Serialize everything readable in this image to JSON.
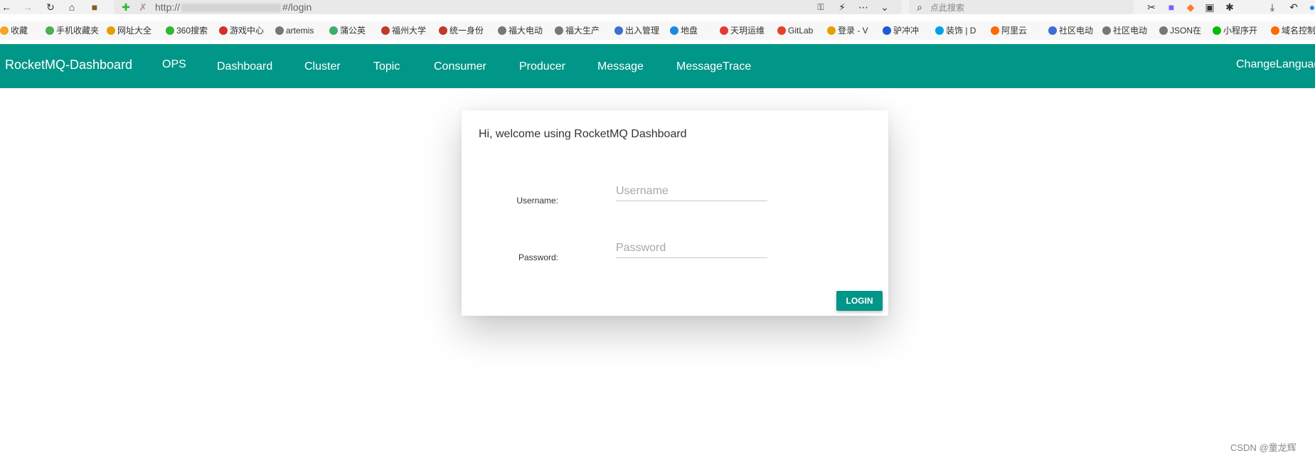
{
  "browser": {
    "url_prefix": "http://",
    "url_suffix": "#/login",
    "search_placeholder": "点此搜索",
    "bookmarks": [
      {
        "label": "收藏",
        "icon": "star-icon",
        "color": "#f5a623"
      },
      {
        "label": "手机收藏夹",
        "icon": "phone-icon",
        "color": "#4caf50"
      },
      {
        "label": "网址大全",
        "icon": "site-icon",
        "color": "#e5a000"
      },
      {
        "label": "360搜索",
        "icon": "search360-icon",
        "color": "#2eb82e"
      },
      {
        "label": "游戏中心",
        "icon": "game-icon",
        "color": "#d32f2f"
      },
      {
        "label": "artemis",
        "icon": "globe-icon",
        "color": "#777777"
      },
      {
        "label": "蒲公英",
        "icon": "dandelion-icon",
        "color": "#3fae6b"
      },
      {
        "label": "福州大学",
        "icon": "university-icon",
        "color": "#c0392b"
      },
      {
        "label": "统一身份",
        "icon": "identity-icon",
        "color": "#c0392b"
      },
      {
        "label": "福大电动",
        "icon": "globe-icon",
        "color": "#777777"
      },
      {
        "label": "福大生产",
        "icon": "globe-icon",
        "color": "#777777"
      },
      {
        "label": "出入管理",
        "icon": "shield-icon",
        "color": "#3b6fd1"
      },
      {
        "label": "地盘",
        "icon": "ie-icon",
        "color": "#1e88e5"
      },
      {
        "label": "天玥运维",
        "icon": "ops-icon",
        "color": "#e53935"
      },
      {
        "label": "GitLab",
        "icon": "gitlab-icon",
        "color": "#e24329"
      },
      {
        "label": "登录 - V",
        "icon": "key-icon",
        "color": "#e5a000"
      },
      {
        "label": "驴冲冲",
        "icon": "doc-icon",
        "color": "#1e5ad1"
      },
      {
        "label": "装饰 | D",
        "icon": "play-icon",
        "color": "#00a0e9"
      },
      {
        "label": "阿里云",
        "icon": "aliyun-icon",
        "color": "#ff6a00"
      },
      {
        "label": "社区电动",
        "icon": "shield-icon",
        "color": "#3b6fd1"
      },
      {
        "label": "社区电动",
        "icon": "globe-icon",
        "color": "#777777"
      },
      {
        "label": "JSON在",
        "icon": "globe-icon",
        "color": "#777777"
      },
      {
        "label": "小程序开",
        "icon": "wechat-icon",
        "color": "#09bb07"
      },
      {
        "label": "域名控制",
        "icon": "aliyun-icon",
        "color": "#ff6a00"
      }
    ]
  },
  "navbar": {
    "brand": "RocketMQ-Dashboard",
    "items": [
      "OPS",
      "Dashboard",
      "Cluster",
      "Topic",
      "Consumer",
      "Producer",
      "Message",
      "MessageTrace"
    ],
    "change_language": "ChangeLanguage"
  },
  "login": {
    "welcome": "Hi, welcome using RocketMQ Dashboard",
    "username_label": "Username:",
    "username_placeholder": "Username",
    "password_label": "Password:",
    "password_placeholder": "Password",
    "button": "LOGIN"
  },
  "watermark": "CSDN @童龙辉",
  "colors": {
    "primary": "#009688",
    "white": "#ffffff"
  }
}
